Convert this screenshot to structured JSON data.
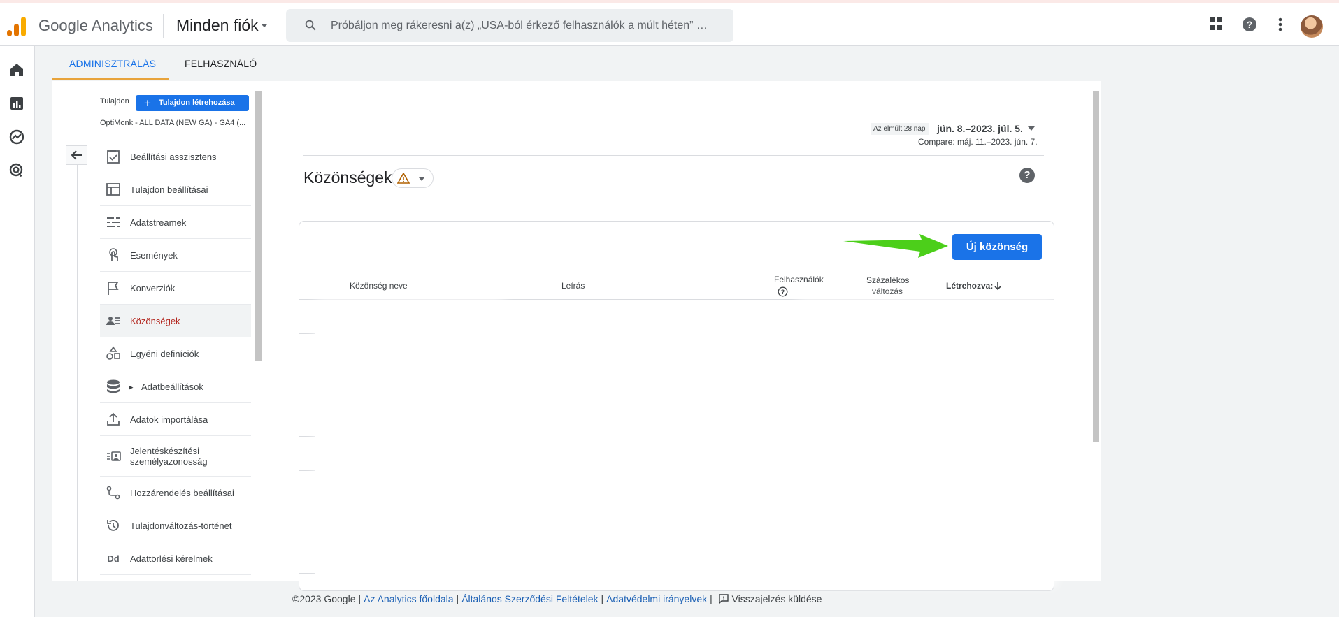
{
  "app": {
    "brand": "Google Analytics",
    "account_selector": "Minden fiók",
    "search_placeholder": "Próbáljon meg rákeresni a(z) „USA-ból érkező felhasználók a múlt héten” …"
  },
  "colors": {
    "accent": "#1a73e8",
    "tab_ink": "#e8a33b",
    "selected_text": "#b3261e",
    "arrow": "#4ccf1a"
  },
  "tabs": [
    {
      "label": "ADMINISZTRÁLÁS",
      "active": true
    },
    {
      "label": "FELHASZNÁLÓ",
      "active": false
    }
  ],
  "property": {
    "label": "Tulajdon",
    "create_button": "Tulajdon létrehozása",
    "name": "OptiMonk - ALL DATA (NEW GA) - GA4 (..."
  },
  "menu": [
    {
      "icon": "checklist-icon",
      "label": "Beállítási asszisztens"
    },
    {
      "icon": "layout-icon",
      "label": "Tulajdon beállításai"
    },
    {
      "icon": "streams-icon",
      "label": "Adatstreamek"
    },
    {
      "icon": "touch-icon",
      "label": "Események"
    },
    {
      "icon": "flag-icon",
      "label": "Konverziók"
    },
    {
      "icon": "audience-icon",
      "label": "Közönségek",
      "selected": true
    },
    {
      "icon": "shapes-icon",
      "label": "Egyéni definíciók"
    },
    {
      "icon": "database-icon",
      "label": "Adatbeállítások",
      "expandable": true
    },
    {
      "icon": "upload-icon",
      "label": "Adatok importálása"
    },
    {
      "icon": "id-card-icon",
      "label": "Jelentéskészítési személyazonosság"
    },
    {
      "icon": "attribution-icon",
      "label": "Hozzárendelés beállításai"
    },
    {
      "icon": "history-icon",
      "label": "Tulajdonváltozás-történet"
    },
    {
      "icon": "dd-icon",
      "label": "Adattörlési kérelmek"
    }
  ],
  "date": {
    "chip": "Az elmúlt 28 nap",
    "range": "jún. 8.–2023. júl. 5.",
    "compare": "Compare: máj. 11.–2023. jún. 7."
  },
  "page": {
    "title": "Közönségek",
    "new_audience_button": "Új közönség"
  },
  "table": {
    "columns": {
      "name": "Közönség neve",
      "description": "Leírás",
      "users": "Felhasználók",
      "pct_change_1": "Százalékos",
      "pct_change_2": "változás",
      "created": "Létrehozva:"
    }
  },
  "footer": {
    "copyright": "©2023 Google",
    "link_home": "Az Analytics főoldala",
    "link_terms": "Általános Szerződési Feltételek",
    "link_privacy": "Adatvédelmi irányelvek",
    "feedback": "Visszajelzés küldése"
  }
}
